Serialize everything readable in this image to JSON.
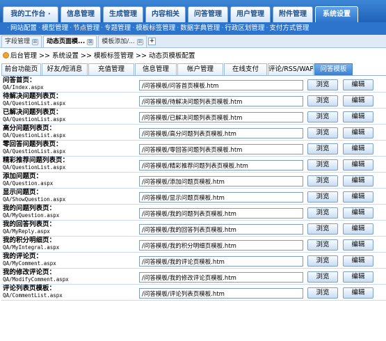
{
  "topnav": {
    "tabs": [
      {
        "label": "我的工作台 ·",
        "width": 80
      },
      {
        "label": "信息管理",
        "width": 58
      },
      {
        "label": "生成管理",
        "width": 58
      },
      {
        "label": "内容相关",
        "width": 58
      },
      {
        "label": "问答管理",
        "width": 58
      },
      {
        "label": "用户管理",
        "width": 58
      },
      {
        "label": "附件管理",
        "width": 58
      },
      {
        "label": "系统设置",
        "width": 62,
        "active": true
      }
    ]
  },
  "subnav": {
    "items": [
      "网站配置",
      "模型管理",
      "节点管理",
      "专题管理",
      "模板标签管理",
      "数据字典管理",
      "行政区划管理",
      "支付方式管理"
    ]
  },
  "wintabs": {
    "tabs": [
      {
        "label": "字段管理",
        "close": "⊠"
      },
      {
        "label": "动态页面模...",
        "close": "⊠",
        "active": true
      },
      {
        "label": "模板添加/...",
        "close": "⊠"
      }
    ],
    "plus": "+"
  },
  "breadcrumb": {
    "items": [
      "后台管理",
      "系统设置",
      "模板标签管理",
      "动态页模板配置"
    ],
    "separator": ">>"
  },
  "modtabs": [
    {
      "label": "前台功能页",
      "width": 57
    },
    {
      "label": "好友/短消息",
      "width": 66
    },
    {
      "label": "充值管理",
      "width": 66
    },
    {
      "label": "信息管理",
      "width": 60
    },
    {
      "label": "帐户管理",
      "width": 66
    },
    {
      "label": "在线支付",
      "width": 62
    },
    {
      "label": "评论/RSS/WAP",
      "width": 66
    },
    {
      "label": "问答模板",
      "width": 55,
      "active": true
    }
  ],
  "buttons": {
    "browse": "浏览",
    "edit": "编辑"
  },
  "rows": [
    {
      "title": "问答首页：",
      "path": "QA/Index.aspx",
      "value": "/问答模板/问答首页模板.htm"
    },
    {
      "title": "待解决问题列表页：",
      "path": "QA/QuestionList.aspx",
      "value": "/问答模板/待解决问题列表页模板.htm"
    },
    {
      "title": "已解决问题列表页：",
      "path": "QA/QuestionList.aspx",
      "value": "/问答模板/已解决问题列表页模板.htm"
    },
    {
      "title": "高分问题列表页：",
      "path": "QA/QuestionList.aspx",
      "value": "/问答模板/高分问题列表页模板.htm"
    },
    {
      "title": "零回答问题列表页：",
      "path": "QA/QuestionList.aspx",
      "value": "/问答模板/零回答问题列表页模板.htm"
    },
    {
      "title": "精彩推荐问题列表页：",
      "path": "QA/QuestionList.aspx",
      "value": "/问答模板/精彩推荐问题列表页模板.htm"
    },
    {
      "title": "添加问题页：",
      "path": "QA/Question.aspx",
      "value": "/问答模板/添加问题页模板.htm"
    },
    {
      "title": "显示问题页：",
      "path": "QA/ShowQuestion.aspx",
      "value": "/问答模板/显示问题页模板.htm"
    },
    {
      "title": "我的问题列表页：",
      "path": "QA/MyQuestion.aspx",
      "value": "/问答模板/我的问题列表页模板.htm"
    },
    {
      "title": "我的回答列表页：",
      "path": "QA/MyReply.aspx",
      "value": "/问答模板/我的回答列表页模板.htm"
    },
    {
      "title": "我的积分明细页：",
      "path": "QA/MyIntegral.aspx",
      "value": "/问答模板/我的积分明细页模板.htm"
    },
    {
      "title": "我的评论页：",
      "path": "QA/MyComment.aspx",
      "value": "/问答模板/我的评论页模板.htm"
    },
    {
      "title": "我的修改评论页：",
      "path": "QA/ModifyComment.aspx",
      "value": "/问答模板/我的修改评论页模板.htm"
    },
    {
      "title": "评论列表页模板：",
      "path": "QA/CommentList.aspx",
      "value": "/问答模板/评论列表页模板.htm"
    }
  ],
  "colors": {
    "accent": "#2c74cc",
    "nav_top": "#3d86d6",
    "border": "#9dbde3"
  }
}
